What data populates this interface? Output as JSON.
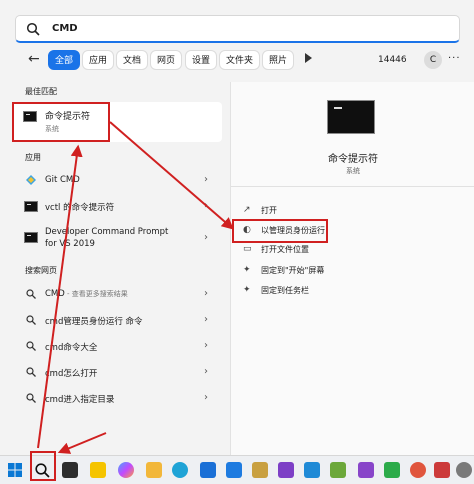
{
  "search": {
    "query": "CMD"
  },
  "filters": {
    "back": "←",
    "chips": [
      "全部",
      "应用",
      "文档",
      "网页",
      "设置",
      "文件夹",
      "照片"
    ],
    "count": "14446",
    "avatar": "C",
    "more": "···"
  },
  "sections": {
    "best": "最佳匹配",
    "apps": "应用",
    "web": "搜索网页"
  },
  "best_match": {
    "title": "命令提示符",
    "sub": "系统"
  },
  "apps": [
    {
      "label": "Git CMD"
    },
    {
      "label": "vctl 的命令提示符"
    },
    {
      "label": "Developer Command Prompt",
      "label2": "for VS 2019"
    }
  ],
  "web": [
    {
      "label": "CMD",
      "suffix": " - 查看更多搜索结果"
    },
    {
      "label": "cmd管理员身份运行 命令"
    },
    {
      "label": "cmd命令大全"
    },
    {
      "label": "cmd怎么打开"
    },
    {
      "label": "cmd进入指定目录"
    }
  ],
  "right": {
    "title": "命令提示符",
    "sub": "系统",
    "actions": [
      "打开",
      "以管理员身份运行",
      "打开文件位置",
      "固定到\"开始\"屏幕",
      "固定到任务栏"
    ]
  },
  "colors": {
    "accent": "#1a73e8",
    "annotation": "#d02020"
  }
}
